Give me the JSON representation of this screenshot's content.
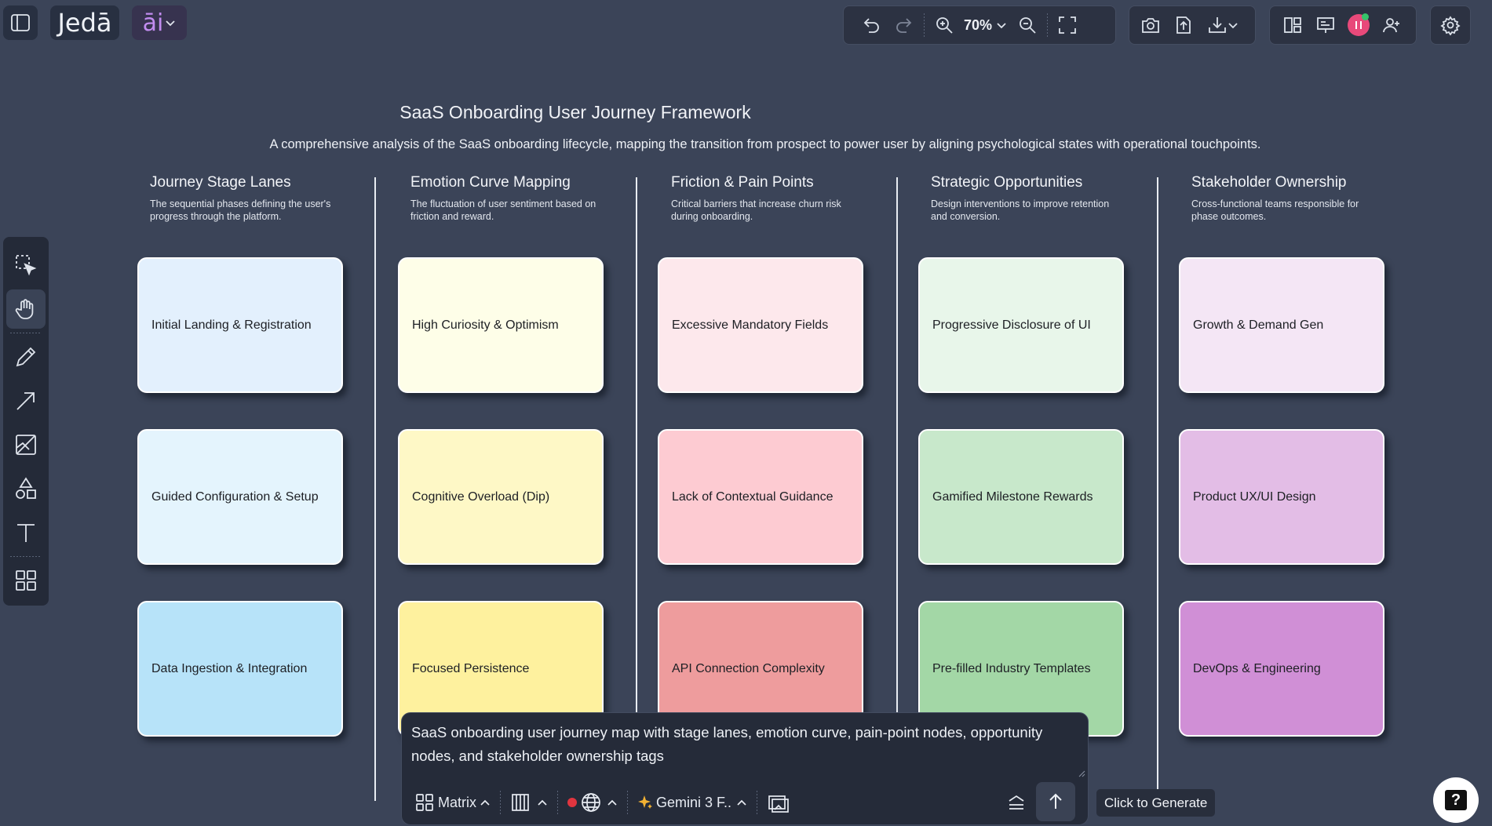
{
  "app": {
    "logo_text": "Jedā",
    "ai_label": "āi"
  },
  "toolbar": {
    "zoom_level": "70%"
  },
  "canvas": {
    "title": "SaaS Onboarding User Journey Framework",
    "subtitle": "A comprehensive analysis of the SaaS onboarding lifecycle, mapping the transition from prospect to power user by aligning psychological states with operational touchpoints.",
    "columns": [
      {
        "heading": "Journey Stage Lanes",
        "description": "The sequential phases defining the user's progress through the platform.",
        "cards": [
          "Initial Landing & Registration",
          "Guided Configuration & Setup",
          "Data Ingestion & Integration"
        ],
        "colors": [
          "#e3f0fd",
          "#e4f4fd",
          "#b7e3f9"
        ]
      },
      {
        "heading": "Emotion Curve Mapping",
        "description": "The fluctuation of user sentiment based on friction and reward.",
        "cards": [
          "High Curiosity & Optimism",
          "Cognitive Overload (Dip)",
          "Focused Persistence"
        ],
        "colors": [
          "#fefee8",
          "#fef8c6",
          "#fef19e"
        ]
      },
      {
        "heading": "Friction & Pain Points",
        "description": "Critical barriers that increase churn risk during onboarding.",
        "cards": [
          "Excessive Mandatory Fields",
          "Lack of Contextual Guidance",
          "API Connection Complexity"
        ],
        "colors": [
          "#fde8ec",
          "#fdcbd2",
          "#ee9c9d"
        ]
      },
      {
        "heading": "Strategic Opportunities",
        "description": "Design interventions to improve retention and conversion.",
        "cards": [
          "Progressive Disclosure of UI",
          "Gamified Milestone Rewards",
          "Pre-filled Industry Templates"
        ],
        "colors": [
          "#e8f6ea",
          "#c8e8cb",
          "#a3d7a6"
        ]
      },
      {
        "heading": "Stakeholder Ownership",
        "description": "Cross-functional teams responsible for phase outcomes.",
        "cards": [
          "Growth & Demand Gen",
          "Product UX/UI Design",
          "DevOps & Engineering"
        ],
        "colors": [
          "#f4e6f5",
          "#e3bde6",
          "#d08fd6"
        ]
      }
    ]
  },
  "prompt": {
    "text": "SaaS onboarding user journey map with stage lanes, emotion curve, pain-point nodes, opportunity nodes, and stakeholder ownership tags",
    "layout_label": "Matrix",
    "model_label": "Gemini 3 F..",
    "send_tooltip": "Click to Generate"
  },
  "colors": {
    "background": "#3b4458",
    "panel": "#2c3242",
    "avatar": "#e8497a",
    "record_dot": "#e0353f"
  }
}
